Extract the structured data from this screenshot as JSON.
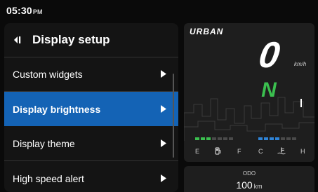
{
  "status": {
    "time": "05:30",
    "ampm": "PM"
  },
  "menu": {
    "title": "Display setup",
    "items": [
      {
        "label": "Custom widgets",
        "active": false
      },
      {
        "label": "Display brightness",
        "active": true
      },
      {
        "label": "Display theme",
        "active": false
      },
      {
        "label": "High speed alert",
        "active": false
      }
    ]
  },
  "dashboard": {
    "mode": "URBAN",
    "speed": "0",
    "speed_unit": "km/h",
    "gear": "N",
    "fuel_empty": "E",
    "fuel_full": "F",
    "temp_cold": "C",
    "temp_hot": "H",
    "fuel_level": 0.43,
    "temp_level": 0.57
  },
  "odo": {
    "label": "ODO",
    "value": "100",
    "unit": "km"
  },
  "colors": {
    "accent": "#1463b5",
    "gear": "#3bbf4f",
    "fuel": "#3bbf4f",
    "temp": "#2f84d8"
  }
}
